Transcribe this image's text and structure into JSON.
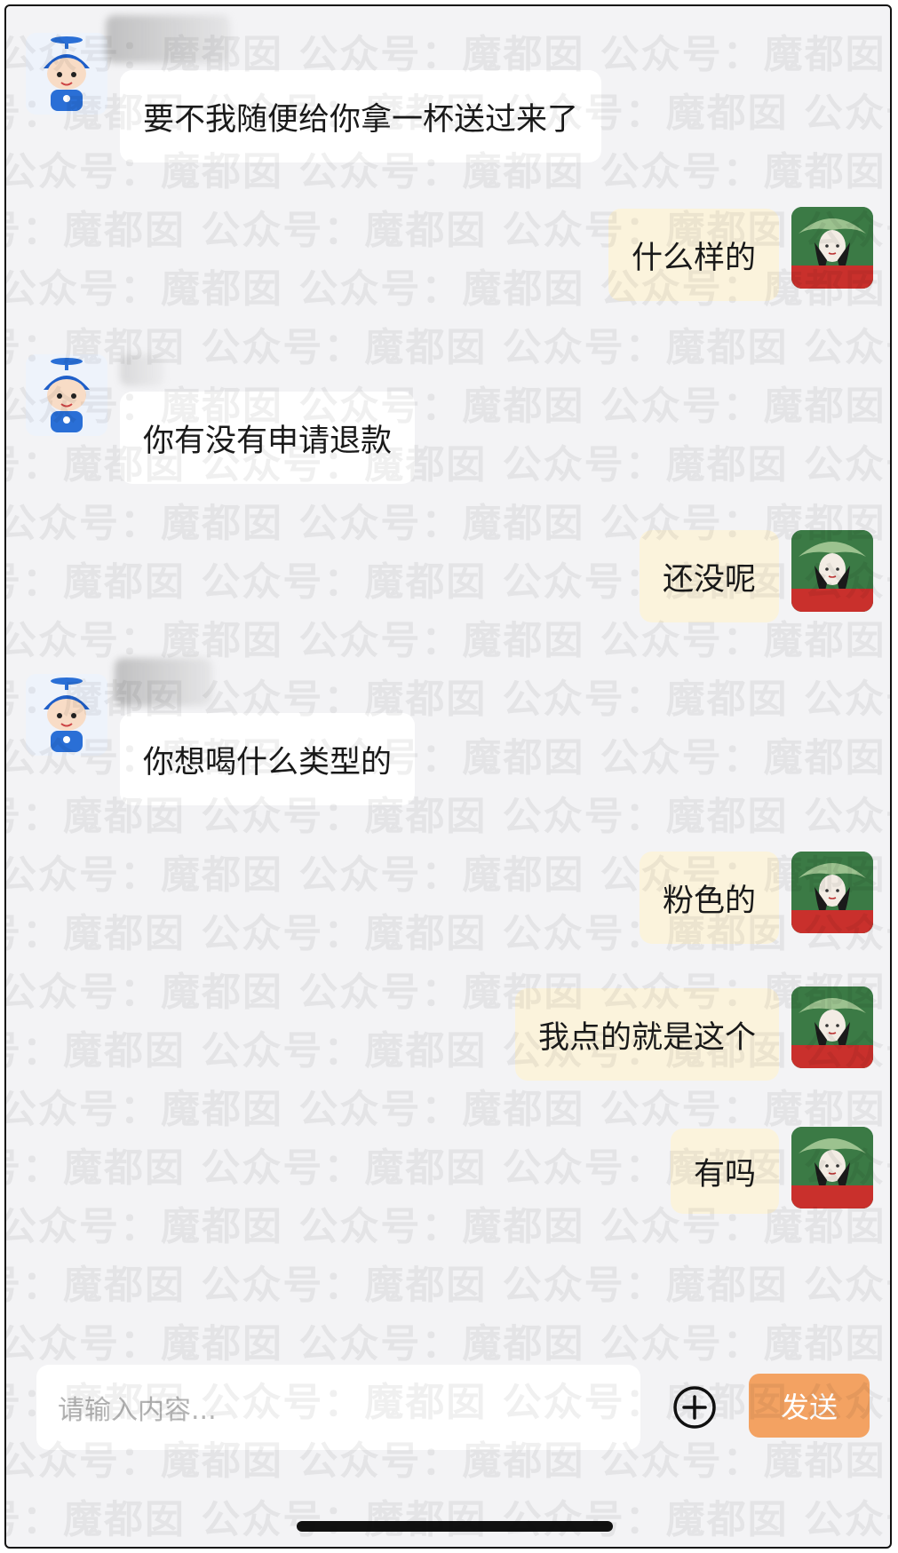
{
  "messages": [
    {
      "side": "left",
      "text": "要不我随便给你拿一杯送过来了"
    },
    {
      "side": "right",
      "text": "什么样的"
    },
    {
      "side": "left",
      "text": "你有没有申请退款"
    },
    {
      "side": "right",
      "text": "还没呢"
    },
    {
      "side": "left",
      "text": "你想喝什么类型的"
    },
    {
      "side": "right",
      "text": "粉色的"
    },
    {
      "side": "right",
      "text": "我点的就是这个"
    },
    {
      "side": "right",
      "text": "有吗"
    }
  ],
  "input": {
    "placeholder": "请输入内容..."
  },
  "toolbar": {
    "send_label": "发送",
    "add_icon": "plus-circle-icon"
  },
  "watermark": {
    "text": "公众号：魔都囡"
  },
  "colors": {
    "background": "#f3f3f5",
    "left_bubble": "#ffffff",
    "right_bubble": "#fbf3dc",
    "send_button": "#f3a262"
  }
}
